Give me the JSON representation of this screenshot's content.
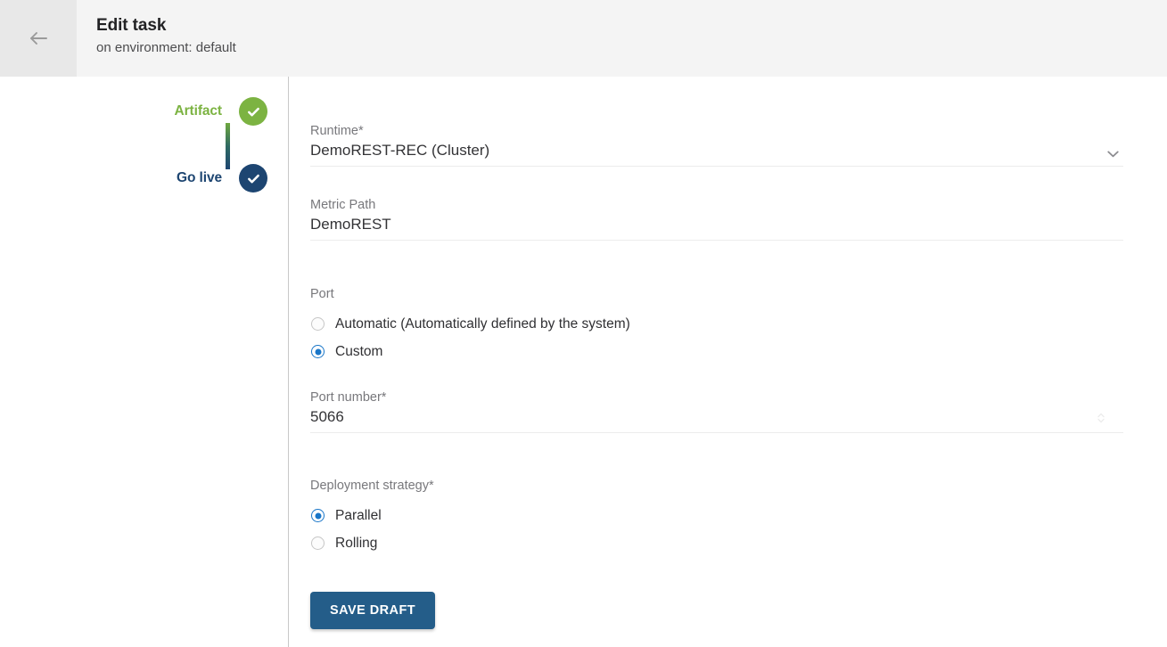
{
  "header": {
    "back_icon": "arrow-left-icon",
    "title": "Edit task",
    "subtitle": "on environment: default"
  },
  "stepper": {
    "steps": [
      {
        "label": "Artifact",
        "state": "complete",
        "color": "#7cb342",
        "icon": "check-icon"
      },
      {
        "label": "Go live",
        "state": "complete",
        "color": "#1d4571",
        "icon": "check-icon"
      }
    ]
  },
  "form": {
    "runtime": {
      "label": "Runtime*",
      "value": "DemoREST-REC  (Cluster)",
      "dropdown_icon": "chevron-down-icon"
    },
    "metric_path": {
      "label": "Metric Path",
      "value": "DemoREST",
      "placeholder": "Metric Path"
    },
    "port": {
      "label": "Port",
      "options": [
        {
          "label": "Automatic (Automatically defined by the system)",
          "selected": false
        },
        {
          "label": "Custom",
          "selected": true
        }
      ]
    },
    "port_number": {
      "label": "Port number*",
      "value": "5066",
      "placeholder": "Port number",
      "spinner_icon": "number-spinner-icon"
    },
    "deployment_strategy": {
      "label": "Deployment strategy*",
      "options": [
        {
          "label": "Parallel",
          "selected": true
        },
        {
          "label": "Rolling",
          "selected": false
        }
      ]
    },
    "actions": {
      "save_draft_label": "SAVE DRAFT"
    }
  },
  "colors": {
    "accent_blue": "#245d89",
    "radio_blue": "#1976c8",
    "step_green": "#7cb342",
    "step_navy": "#1d4571",
    "header_bg": "#f4f4f4",
    "back_bg": "#e8e8e8"
  }
}
